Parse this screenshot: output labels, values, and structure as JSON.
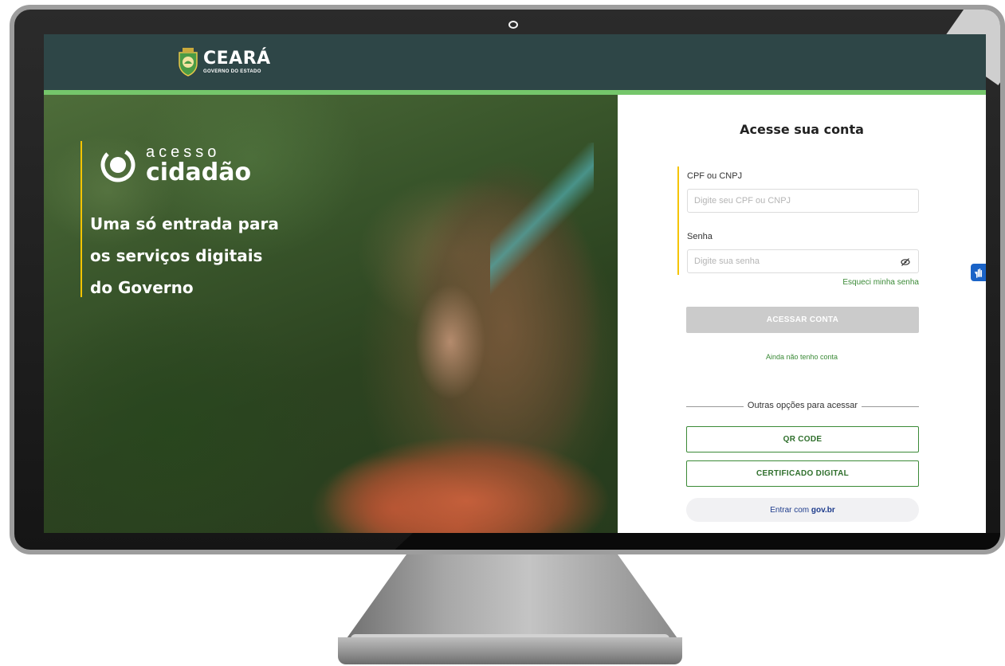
{
  "header": {
    "logo_title": "CEARÁ",
    "logo_subtitle": "GOVERNO DO ESTADO"
  },
  "hero": {
    "brand_top": "acesso",
    "brand_bottom": "cidadão",
    "tagline_lines": [
      "Uma só entrada para",
      "os serviços digitais",
      "do Governo"
    ]
  },
  "login": {
    "title": "Acesse sua conta",
    "cpf_label": "CPF ou CNPJ",
    "cpf_placeholder": "Digite seu CPF ou CNPJ",
    "cpf_value": "",
    "password_label": "Senha",
    "password_placeholder": "Digite sua senha",
    "password_value": "",
    "forgot_link": "Esqueci minha senha",
    "submit_button": "ACESSAR CONTA",
    "register_link": "Ainda não tenho conta",
    "other_options_label": "Outras opções para acessar",
    "qr_button": "QR CODE",
    "certificate_button": "CERTIFICADO DIGITAL",
    "govbr_prefix": "Entrar com",
    "govbr_brand": "gov.br"
  },
  "colors": {
    "header_bg": "#2e4647",
    "header_accent": "#75c66b",
    "brand_accent": "#f5c400",
    "link_green": "#3b8a37",
    "govbr_blue": "#1e3c8c",
    "vlibras_blue": "#1a63c7"
  },
  "icons": {
    "logo": "ceara-crest-icon",
    "brand": "acesso-cidadao-icon",
    "password_toggle": "eye-slash-icon",
    "accessibility": "vlibras-hand-icon"
  }
}
